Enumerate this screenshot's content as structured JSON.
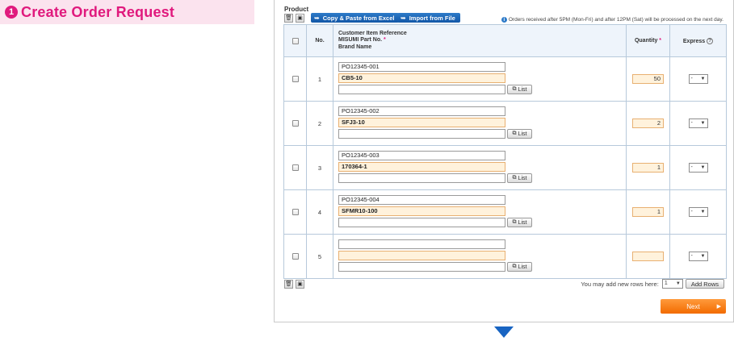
{
  "step": {
    "number": "1",
    "title": "Create Order Request"
  },
  "toolbar": {
    "product_label": "Product",
    "copy_paste_label": "Copy & Paste from Excel",
    "import_label": "Import from File",
    "notice": "Orders received after 5PM (Mon-Fri) and after 12PM (Sat) will be processed on the next day."
  },
  "table": {
    "headers": {
      "no": "No.",
      "item_line1": "Customer Item Reference",
      "item_line2": "MISUMI Part No.",
      "item_line3": "Brand Name",
      "quantity": "Quantity",
      "express": "Express",
      "required_mark": "*",
      "help_mark": "?"
    },
    "list_label": "List",
    "rows": [
      {
        "no": "1",
        "customer_ref": "PO12345-001",
        "part_no": "CB5-10",
        "brand": "",
        "quantity": "50",
        "express": "-"
      },
      {
        "no": "2",
        "customer_ref": "PO12345-002",
        "part_no": "SFJ3-10",
        "brand": "",
        "quantity": "2",
        "express": "-"
      },
      {
        "no": "3",
        "customer_ref": "PO12345-003",
        "part_no": "170364-1",
        "brand": "",
        "quantity": "1",
        "express": "-"
      },
      {
        "no": "4",
        "customer_ref": "PO12345-004",
        "part_no": "SFMR10-100",
        "brand": "",
        "quantity": "1",
        "express": "-"
      },
      {
        "no": "5",
        "customer_ref": "",
        "part_no": "",
        "brand": "",
        "quantity": "",
        "express": "-"
      }
    ]
  },
  "footer": {
    "add_rows_text": "You may add new rows here:",
    "rows_count": "1",
    "add_rows_label": "Add Rows",
    "next_label": "Next"
  },
  "icons": {
    "delete": "trash-icon",
    "move": "folder-move-icon",
    "arrow": "arrow-right-icon",
    "info": "info-icon",
    "dropdown": "chevron-down-icon",
    "list": "window-icon",
    "scroll_down": "triangle-down-icon"
  },
  "colors": {
    "accent_pink": "#e0197d",
    "button_blue": "#1864c2",
    "next_orange": "#f26b00",
    "highlight_field": "#fff2dc"
  }
}
